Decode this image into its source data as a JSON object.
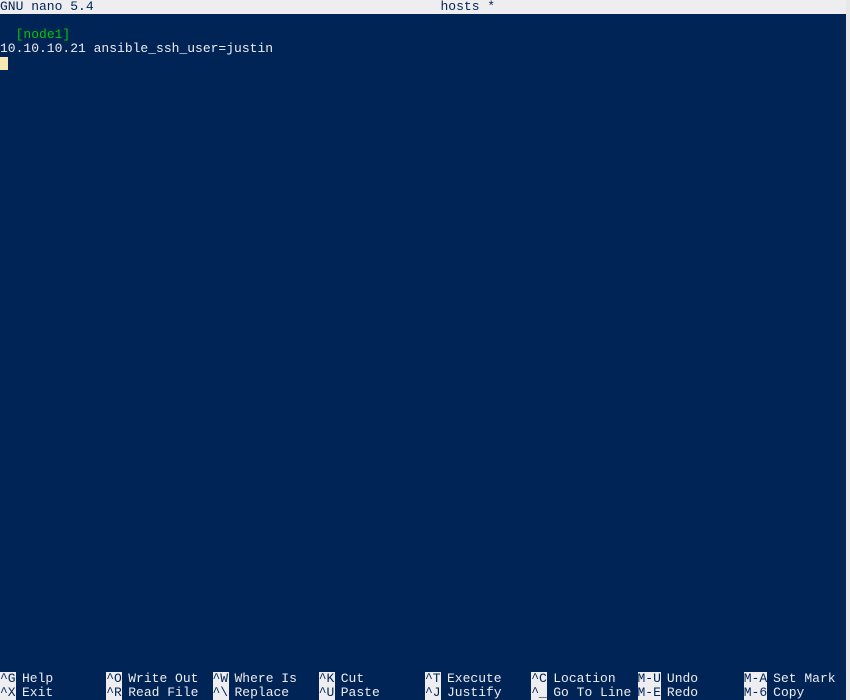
{
  "titlebar": {
    "left": "  GNU nano 5.4",
    "center": "hosts *",
    "right": ""
  },
  "content": {
    "group": "[node1]",
    "line1": "10.10.10.21 ansible_ssh_user=justin"
  },
  "shortcuts": {
    "row1": [
      {
        "key": "^G",
        "desc": "Help"
      },
      {
        "key": "^O",
        "desc": "Write Out"
      },
      {
        "key": "^W",
        "desc": "Where Is"
      },
      {
        "key": "^K",
        "desc": "Cut"
      },
      {
        "key": "^T",
        "desc": "Execute"
      },
      {
        "key": "^C",
        "desc": "Location"
      },
      {
        "key": "M-U",
        "desc": "Undo"
      },
      {
        "key": "M-A",
        "desc": "Set Mark"
      }
    ],
    "row2": [
      {
        "key": "^X",
        "desc": "Exit"
      },
      {
        "key": "^R",
        "desc": "Read File"
      },
      {
        "key": "^\\",
        "desc": "Replace"
      },
      {
        "key": "^U",
        "desc": "Paste"
      },
      {
        "key": "^J",
        "desc": "Justify"
      },
      {
        "key": "^_",
        "desc": "Go To Line"
      },
      {
        "key": "M-E",
        "desc": "Redo"
      },
      {
        "key": "M-6",
        "desc": "Copy"
      }
    ]
  }
}
